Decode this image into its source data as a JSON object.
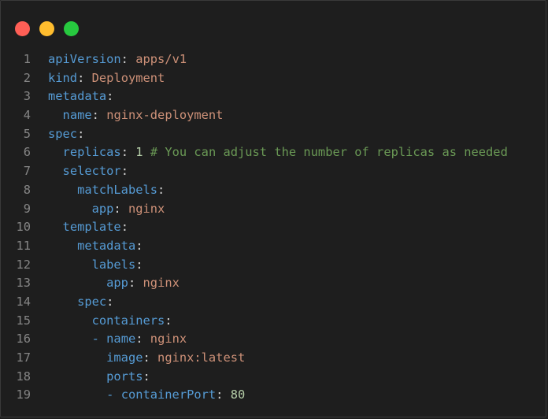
{
  "window": {
    "controls": [
      {
        "name": "close",
        "color": "#ff5f56"
      },
      {
        "name": "minimize",
        "color": "#ffbd2e"
      },
      {
        "name": "maximize",
        "color": "#27c93f"
      }
    ]
  },
  "colors": {
    "background": "#1e1e1e",
    "key": "#569cd6",
    "string": "#ce9178",
    "number": "#b5cea8",
    "comment": "#6a9955",
    "line_number": "#858585"
  },
  "code": {
    "lines": [
      {
        "n": "1",
        "indent": "",
        "dash": "",
        "key": "apiVersion",
        "value": "apps/v1",
        "vtype": "str",
        "comment": ""
      },
      {
        "n": "2",
        "indent": "",
        "dash": "",
        "key": "kind",
        "value": "Deployment",
        "vtype": "str",
        "comment": ""
      },
      {
        "n": "3",
        "indent": "",
        "dash": "",
        "key": "metadata",
        "value": "",
        "vtype": "",
        "comment": ""
      },
      {
        "n": "4",
        "indent": "  ",
        "dash": "",
        "key": "name",
        "value": "nginx-deployment",
        "vtype": "str",
        "comment": ""
      },
      {
        "n": "5",
        "indent": "",
        "dash": "",
        "key": "spec",
        "value": "",
        "vtype": "",
        "comment": ""
      },
      {
        "n": "6",
        "indent": "  ",
        "dash": "",
        "key": "replicas",
        "value": "1",
        "vtype": "num",
        "comment": "# You can adjust the number of replicas as needed"
      },
      {
        "n": "7",
        "indent": "  ",
        "dash": "",
        "key": "selector",
        "value": "",
        "vtype": "",
        "comment": ""
      },
      {
        "n": "8",
        "indent": "    ",
        "dash": "",
        "key": "matchLabels",
        "value": "",
        "vtype": "",
        "comment": ""
      },
      {
        "n": "9",
        "indent": "      ",
        "dash": "",
        "key": "app",
        "value": "nginx",
        "vtype": "str",
        "comment": ""
      },
      {
        "n": "10",
        "indent": "  ",
        "dash": "",
        "key": "template",
        "value": "",
        "vtype": "",
        "comment": ""
      },
      {
        "n": "11",
        "indent": "    ",
        "dash": "",
        "key": "metadata",
        "value": "",
        "vtype": "",
        "comment": ""
      },
      {
        "n": "12",
        "indent": "      ",
        "dash": "",
        "key": "labels",
        "value": "",
        "vtype": "",
        "comment": ""
      },
      {
        "n": "13",
        "indent": "        ",
        "dash": "",
        "key": "app",
        "value": "nginx",
        "vtype": "str",
        "comment": ""
      },
      {
        "n": "14",
        "indent": "    ",
        "dash": "",
        "key": "spec",
        "value": "",
        "vtype": "",
        "comment": ""
      },
      {
        "n": "15",
        "indent": "      ",
        "dash": "",
        "key": "containers",
        "value": "",
        "vtype": "",
        "comment": ""
      },
      {
        "n": "16",
        "indent": "      ",
        "dash": "- ",
        "key": "name",
        "value": "nginx",
        "vtype": "str",
        "comment": ""
      },
      {
        "n": "17",
        "indent": "        ",
        "dash": "",
        "key": "image",
        "value": "nginx:latest",
        "vtype": "str",
        "comment": ""
      },
      {
        "n": "18",
        "indent": "        ",
        "dash": "",
        "key": "ports",
        "value": "",
        "vtype": "",
        "comment": ""
      },
      {
        "n": "19",
        "indent": "        ",
        "dash": "- ",
        "key": "containerPort",
        "value": "80",
        "vtype": "num",
        "comment": ""
      }
    ]
  }
}
